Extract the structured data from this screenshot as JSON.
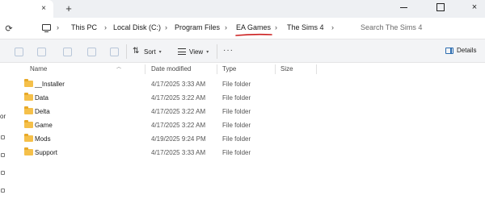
{
  "window": {
    "close_glyph": "×",
    "new_tab_glyph": "+"
  },
  "address": {
    "crumbs": [
      "This PC",
      "Local Disk (C:)",
      "Program Files",
      "EA Games",
      "The Sims 4"
    ],
    "highlight_color": "#cc1f1f",
    "search_placeholder": "Search The Sims 4"
  },
  "toolbar": {
    "sort_label": "Sort",
    "view_label": "View",
    "more_label": "···",
    "details_label": "Details"
  },
  "columns": {
    "name": "Name",
    "date": "Date modified",
    "type": "Type",
    "size": "Size"
  },
  "files": [
    {
      "name": "__Installer",
      "date": "4/17/2025 3:33 AM",
      "type": "File folder",
      "size": ""
    },
    {
      "name": "Data",
      "date": "4/17/2025 3:22 AM",
      "type": "File folder",
      "size": ""
    },
    {
      "name": "Delta",
      "date": "4/17/2025 3:22 AM",
      "type": "File folder",
      "size": ""
    },
    {
      "name": "Game",
      "date": "4/17/2025 3:22 AM",
      "type": "File folder",
      "size": ""
    },
    {
      "name": "Mods",
      "date": "4/19/2025 9:24 PM",
      "type": "File folder",
      "size": ""
    },
    {
      "name": "Support",
      "date": "4/17/2025 3:33 AM",
      "type": "File folder",
      "size": ""
    }
  ],
  "navpane": {
    "fragment": "or"
  },
  "colors": {
    "folder": "#f5c04a",
    "accent": "#2b6cb0"
  }
}
